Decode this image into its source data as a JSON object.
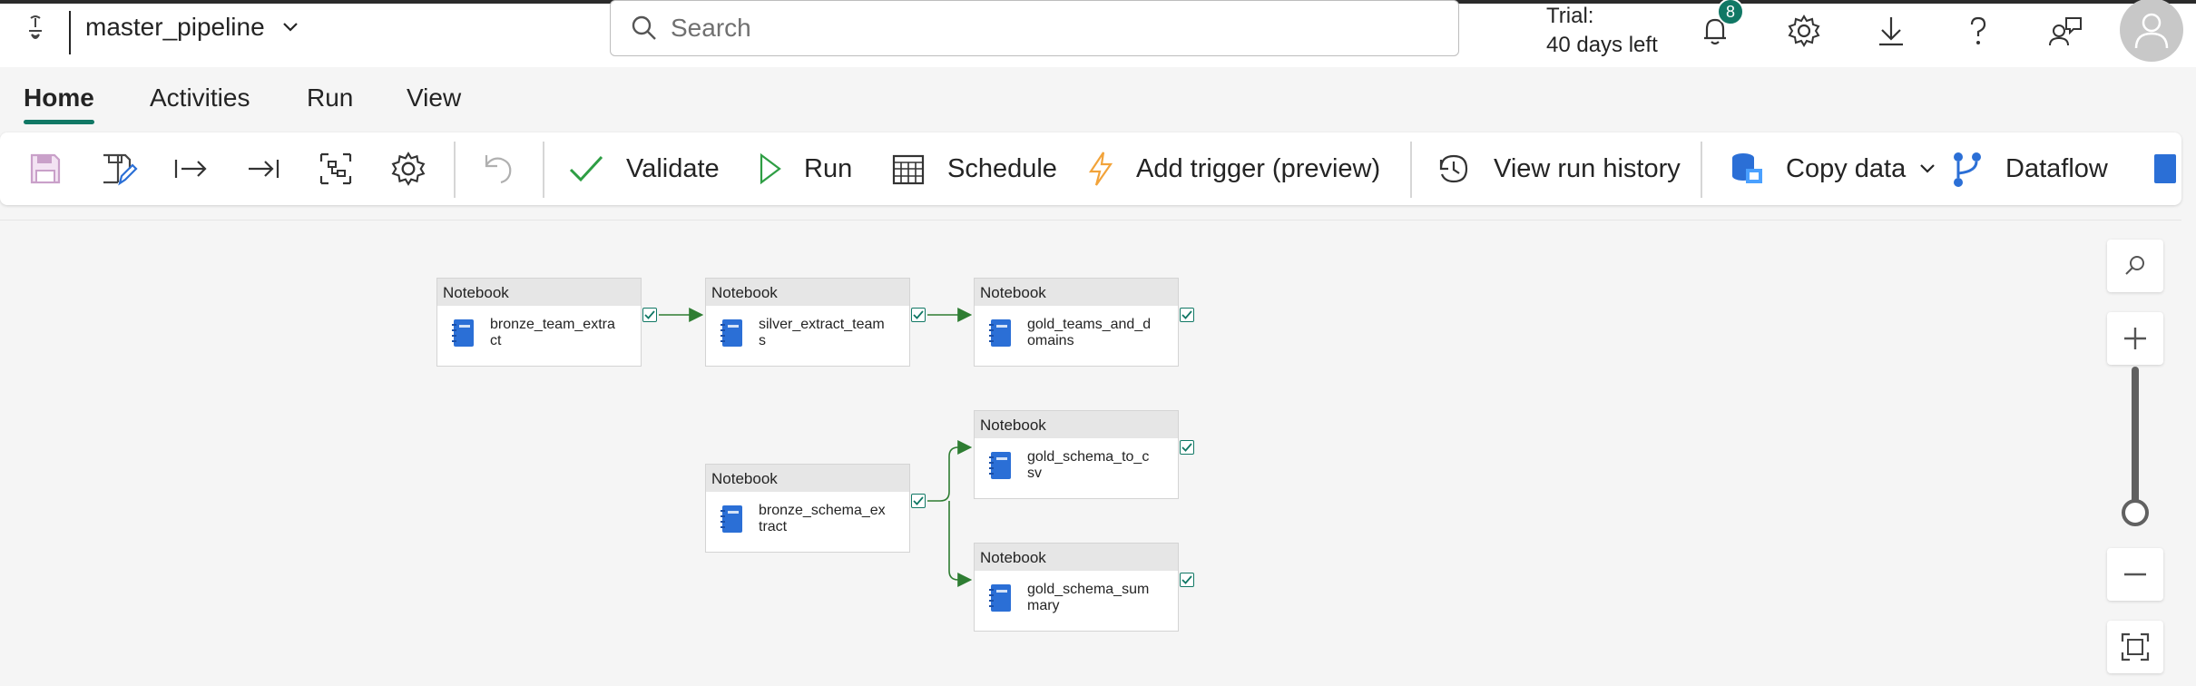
{
  "header": {
    "pipeline_name": "master_pipeline",
    "search_placeholder": "Search",
    "trial_line1": "Trial:",
    "trial_line2": "40 days left",
    "notification_count": "8",
    "icons": [
      "bell-icon",
      "gear-icon",
      "download-icon",
      "help-icon",
      "feedback-icon",
      "avatar-icon"
    ]
  },
  "tabs": [
    {
      "label": "Home",
      "active": true
    },
    {
      "label": "Activities",
      "active": false
    },
    {
      "label": "Run",
      "active": false
    },
    {
      "label": "View",
      "active": false
    }
  ],
  "toolbar": {
    "validate": "Validate",
    "run": "Run",
    "schedule": "Schedule",
    "add_trigger": "Add trigger (preview)",
    "view_run_history": "View run history",
    "copy_data": "Copy data",
    "dataflow": "Dataflow"
  },
  "nodes": [
    {
      "type": "Notebook",
      "name": "bronze_team_extract"
    },
    {
      "type": "Notebook",
      "name": "silver_extract_teams"
    },
    {
      "type": "Notebook",
      "name": "gold_teams_and_domains"
    },
    {
      "type": "Notebook",
      "name": "bronze_schema_extract"
    },
    {
      "type": "Notebook",
      "name": "gold_schema_to_csv"
    },
    {
      "type": "Notebook",
      "name": "gold_schema_summary"
    }
  ],
  "colors": {
    "accent": "#117865",
    "edge": "#2e7d32",
    "notebook_icon": "#2b6fd6",
    "trigger": "#f2a33a",
    "dataflow": "#2b6fd6"
  }
}
